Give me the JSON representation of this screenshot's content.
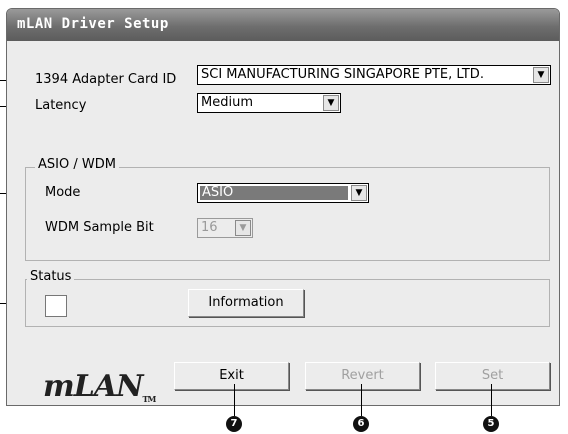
{
  "window": {
    "title": "mLAN Driver Setup"
  },
  "fields": {
    "adapter": {
      "label": "1394 Adapter Card ID",
      "value": "SCI MANUFACTURING SINGAPORE PTE, LTD."
    },
    "latency": {
      "label": "Latency",
      "value": "Medium"
    }
  },
  "asio_group": {
    "caption": "ASIO / WDM",
    "mode": {
      "label": "Mode",
      "value": "ASIO"
    },
    "sample_bit": {
      "label": "WDM Sample Bit",
      "value": "16"
    }
  },
  "status_group": {
    "caption": "Status",
    "info_button": "Information"
  },
  "footer": {
    "logo_text": "mLAN",
    "logo_tm": "TM",
    "exit_button": "Exit",
    "revert_button": "Revert",
    "set_button": "Set"
  },
  "callouts": {
    "c7": "7",
    "c6": "6",
    "c5": "5"
  },
  "icons": [
    "dropdown-arrow-icon"
  ]
}
